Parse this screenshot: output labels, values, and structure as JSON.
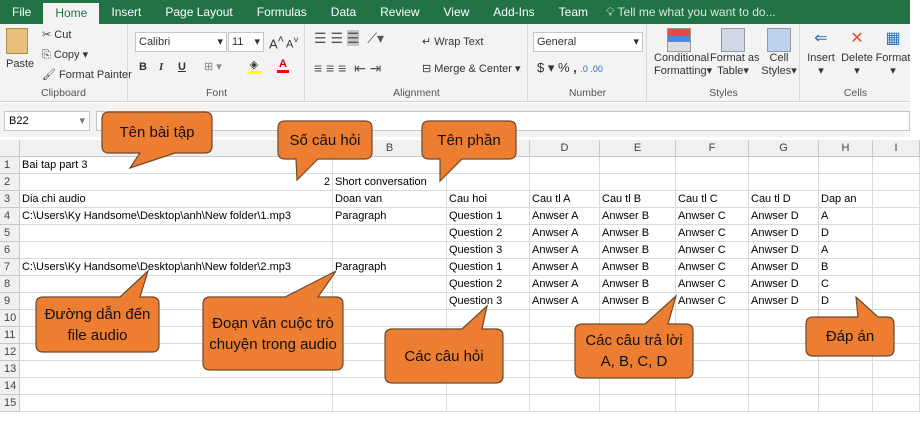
{
  "ribbon": {
    "tabs": [
      "File",
      "Home",
      "Insert",
      "Page Layout",
      "Formulas",
      "Data",
      "Review",
      "View",
      "Add-Ins",
      "Team"
    ],
    "active_tab": "Home",
    "tell_me": "Tell me what you want to do...",
    "clipboard": {
      "paste": "Paste",
      "cut": "Cut",
      "copy": "Copy",
      "format_painter": "Format Painter",
      "label": "Clipboard"
    },
    "font": {
      "name": "Calibri",
      "size": "11",
      "bold": "B",
      "italic": "I",
      "underline": "U",
      "label": "Font",
      "fill_color": "#ffff00",
      "font_color": "#ff0000"
    },
    "alignment": {
      "wrap": "Wrap Text",
      "merge": "Merge & Center",
      "label": "Alignment"
    },
    "number": {
      "format": "General",
      "currency": "$",
      "percent": "%",
      "comma": ",",
      "label": "Number"
    },
    "styles": {
      "conditional": "Conditional",
      "conditional2": "Formatting",
      "format_table": "Format as",
      "format_table2": "Table",
      "cell_styles": "Cell",
      "cell_styles2": "Styles",
      "label": "Styles"
    },
    "cells": {
      "insert": "Insert",
      "delete": "Delete",
      "format": "Format",
      "label": "Cells"
    }
  },
  "name_box": "B22",
  "columns": [
    "A",
    "B",
    "C",
    "D",
    "E",
    "F",
    "G",
    "H",
    "I"
  ],
  "rows": [
    [
      "Bai tap part 3",
      "",
      "",
      "",
      "",
      "",
      "",
      "",
      ""
    ],
    [
      "2",
      "Short conversation",
      "",
      "",
      "",
      "",
      "",
      "",
      ""
    ],
    [
      "Dia chi audio",
      "Doan van",
      "Cau hoi",
      "Cau tl A",
      "Cau tl B",
      "Cau tl C",
      "Cau tl D",
      "Dap an",
      ""
    ],
    [
      "C:\\Users\\Ky Handsome\\Desktop\\anh\\New folder\\1.mp3",
      "Paragraph",
      "Question 1",
      "Anwser A",
      "Anwser B",
      "Anwser C",
      "Anwser D",
      "A",
      ""
    ],
    [
      "",
      "",
      "Question 2",
      "Anwser A",
      "Anwser B",
      "Anwser C",
      "Anwser D",
      "D",
      ""
    ],
    [
      "",
      "",
      "Question 3",
      "Anwser A",
      "Anwser B",
      "Anwser C",
      "Anwser D",
      "A",
      ""
    ],
    [
      "C:\\Users\\Ky Handsome\\Desktop\\anh\\New folder\\2.mp3",
      "Paragraph",
      "Question 1",
      "Anwser A",
      "Anwser B",
      "Anwser C",
      "Anwser D",
      "B",
      ""
    ],
    [
      "",
      "",
      "Question 2",
      "Anwser A",
      "Anwser B",
      "Anwser C",
      "Anwser D",
      "C",
      ""
    ],
    [
      "",
      "",
      "Question 3",
      "Anwser A",
      "Anwser B",
      "Anwser C",
      "Anwser D",
      "D",
      ""
    ],
    [
      "",
      "",
      "",
      "",
      "",
      "",
      "",
      "",
      ""
    ],
    [
      "",
      "",
      "",
      "",
      "",
      "",
      "",
      "",
      ""
    ],
    [
      "",
      "",
      "",
      "",
      "",
      "",
      "",
      "",
      ""
    ],
    [
      "",
      "",
      "",
      "",
      "",
      "",
      "",
      "",
      ""
    ],
    [
      "",
      "",
      "",
      "",
      "",
      "",
      "",
      "",
      ""
    ],
    [
      "",
      "",
      "",
      "",
      "",
      "",
      "",
      "",
      ""
    ]
  ],
  "callouts": [
    "Tên bài tập",
    "Số câu hỏi",
    "Tên phần",
    "Đường dẫn đến file audio",
    "Đoạn văn cuộc trò chuyện trong audio",
    "Các câu hỏi",
    "Các câu trả lời A, B, C, D",
    "Đáp án"
  ],
  "colors": {
    "excel_green": "#217346",
    "callout_fill": "#ED7D31",
    "callout_border": "#6b4a2b"
  }
}
